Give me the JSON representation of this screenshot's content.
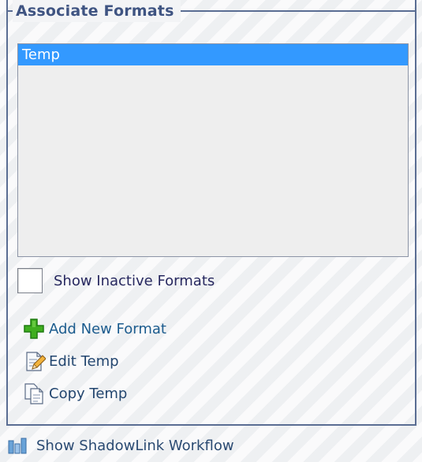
{
  "group": {
    "title": "Associate Formats"
  },
  "formats_list": {
    "items": [
      "Temp"
    ],
    "selected_index": 0
  },
  "show_inactive": {
    "label": "Show Inactive Formats",
    "checked": false
  },
  "actions": {
    "add_label": "Add New Format",
    "edit_label": "Edit Temp",
    "copy_label": "Copy Temp"
  },
  "footer": {
    "workflow_label": "Show ShadowLink Workflow"
  },
  "icons": {
    "add": "plus-icon",
    "edit": "edit-document-icon",
    "copy": "copy-document-icon",
    "workflow": "workflow-bars-icon"
  },
  "colors": {
    "border": "#5a6d93",
    "title": "#3f5482",
    "selection": "#3399ff",
    "plus_green": "#3fae1f"
  }
}
